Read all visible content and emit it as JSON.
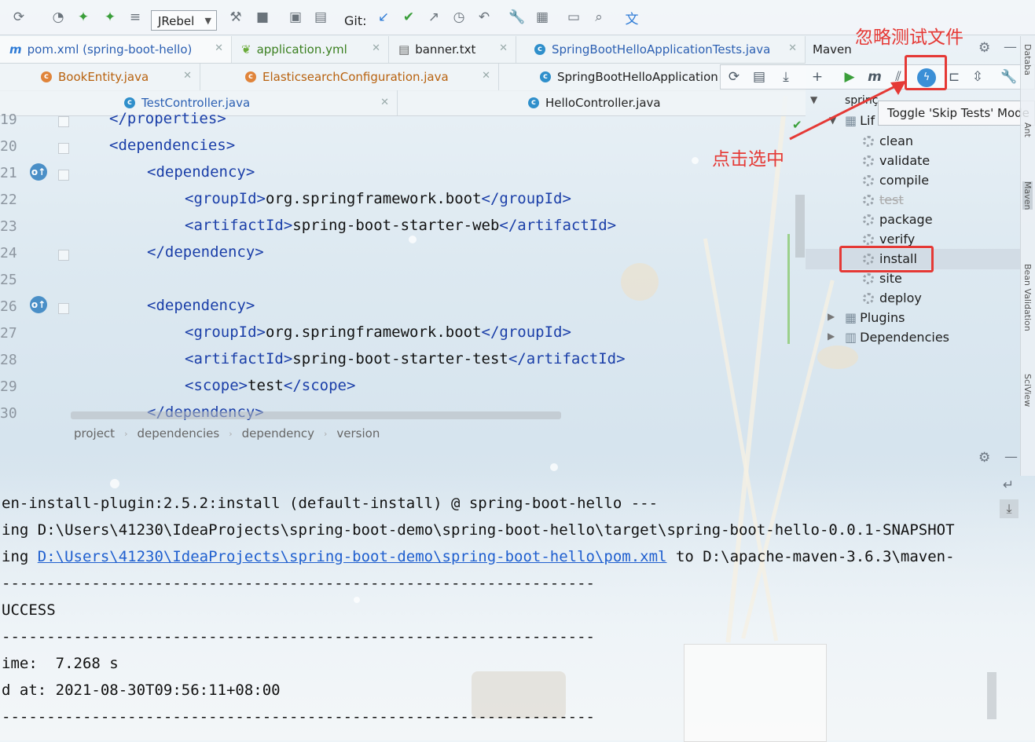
{
  "toolbar": {
    "run_config": "JRebel",
    "git_label": "Git:"
  },
  "tabs_row1": [
    {
      "label": "pom.xml (spring-boot-hello)",
      "icon": "maven-m-icon"
    },
    {
      "label": "application.yml",
      "icon": "spring-leaf-icon"
    },
    {
      "label": "banner.txt",
      "icon": "text-file-icon"
    },
    {
      "label": "SpringBootHelloApplicationTests.java",
      "icon": "class-icon"
    }
  ],
  "tabs_row2": [
    {
      "label": "BookEntity.java"
    },
    {
      "label": "ElasticsearchConfiguration.java"
    },
    {
      "label": "SpringBootHelloApplication"
    }
  ],
  "tabs_row3": [
    {
      "label": "TestController.java"
    },
    {
      "label": "HelloController.java"
    }
  ],
  "editor": {
    "line_numbers": [
      "19",
      "20",
      "21",
      "22",
      "23",
      "24",
      "25",
      "26",
      "27",
      "28",
      "29",
      "30"
    ],
    "lines": [
      {
        "open": "</",
        "tag": "properties",
        "close": ">",
        "text": "",
        "endtag": ""
      },
      {
        "open": "<",
        "tag": "dependencies",
        "close": ">",
        "text": "",
        "endtag": ""
      },
      {
        "open": "<",
        "tag": "dependency",
        "close": ">",
        "text": "",
        "endtag": ""
      },
      {
        "open": "<",
        "tag": "groupId",
        "close": ">",
        "text": "org.springframework.boot",
        "endtag": "</groupId>"
      },
      {
        "open": "<",
        "tag": "artifactId",
        "close": ">",
        "text": "spring-boot-starter-web",
        "endtag": "</artifactId>"
      },
      {
        "open": "</",
        "tag": "dependency",
        "close": ">",
        "text": "",
        "endtag": ""
      },
      {
        "open": "",
        "tag": "",
        "close": "",
        "text": "",
        "endtag": ""
      },
      {
        "open": "<",
        "tag": "dependency",
        "close": ">",
        "text": "",
        "endtag": ""
      },
      {
        "open": "<",
        "tag": "groupId",
        "close": ">",
        "text": "org.springframework.boot",
        "endtag": "</groupId>"
      },
      {
        "open": "<",
        "tag": "artifactId",
        "close": ">",
        "text": "spring-boot-starter-test",
        "endtag": "</artifactId>"
      },
      {
        "open": "<",
        "tag": "scope",
        "close": ">",
        "text": "test",
        "endtag": "</scope>"
      },
      {
        "open": "</",
        "tag": "dependency",
        "close": ">",
        "text": "",
        "endtag": ""
      }
    ]
  },
  "breadcrumb": [
    "project",
    "dependencies",
    "dependency",
    "version"
  ],
  "maven": {
    "title": "Maven",
    "tree_root_partial": "sprinç",
    "lifecycle_partial": "Lif",
    "lifecycle": [
      "clean",
      "validate",
      "compile",
      "test",
      "package",
      "verify",
      "install",
      "site",
      "deploy"
    ],
    "plugins_label": "Plugins",
    "dependencies_label": "Dependencies",
    "tooltip": "Toggle 'Skip Tests' Mode"
  },
  "annotations": {
    "skip_tests": "忽略测试文件",
    "click_select": "点击选中"
  },
  "right_strip": [
    "Databa",
    "Ant",
    "Maven",
    "Bean Validation",
    "SciView"
  ],
  "console": {
    "lines": [
      {
        "pre": "en-install-plugin:2.5.2:install (default-install) @ spring-boot-hello ---",
        "link": "",
        "post": ""
      },
      {
        "pre": "ing D:\\Users\\41230\\IdeaProjects\\spring-boot-demo\\spring-boot-hello\\target\\spring-boot-hello-0.0.1-SNAPSHOT",
        "link": "",
        "post": ""
      },
      {
        "pre": "ing ",
        "link": "D:\\Users\\41230\\IdeaProjects\\spring-boot-demo\\spring-boot-hello\\pom.xml",
        "post": " to D:\\apache-maven-3.6.3\\maven-"
      },
      {
        "pre": "------------------------------------------------------------------",
        "link": "",
        "post": ""
      },
      {
        "pre": "UCCESS",
        "link": "",
        "post": ""
      },
      {
        "pre": "------------------------------------------------------------------",
        "link": "",
        "post": ""
      },
      {
        "pre": "ime:  7.268 s",
        "link": "",
        "post": ""
      },
      {
        "pre": "d at: 2021-08-30T09:56:11+08:00",
        "link": "",
        "post": ""
      },
      {
        "pre": "------------------------------------------------------------------",
        "link": "",
        "post": ""
      }
    ]
  },
  "colors": {
    "tag": "#1a3ea8",
    "annotation_red": "#e53935",
    "link": "#1f5fcf"
  }
}
